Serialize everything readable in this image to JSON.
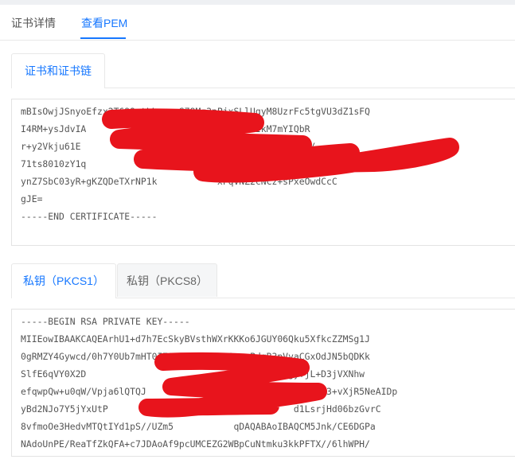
{
  "main_tabs": [
    {
      "label": "证书详情",
      "active": false
    },
    {
      "label": "查看PEM",
      "active": true
    }
  ],
  "cert_section": {
    "tab_label": "证书和证书链",
    "lines": [
      "mBIsOwjJSnyoEfzx2T699ctLLrvuzS79Mg3pPjxSLlUgyM8UzrFc5tgVU3dZ1sFQ",
      "I4RM+ysJdvIA               eqwM3fY3WfQkRTzhIkM7mYIQbR",
      "r+y2Vkju61E                                         6/",
      "71ts8010zY1q                  jdpn+bWUxTKWaMY0qedSCkWE",
      "ynZ7SbC03yR+gKZQDeTXrNP1k           xFqVNZ2cNCz+sPxeOwdCcC",
      "gJE=",
      "-----END CERTIFICATE-----"
    ]
  },
  "key_section": {
    "tabs": [
      {
        "label": "私钥（PKCS1）",
        "active": true
      },
      {
        "label": "私钥（PKCS8）",
        "active": false
      }
    ],
    "lines": [
      "-----BEGIN RSA PRIVATE KEY-----",
      "MIIEowIBAAKCAQEArhU1+d7h7EcSkyBVsthWXrKKKo6JGUY06Qku5XfkcZZMSg1J",
      "0gRMZY4Gywcd/0h7Y0Ub7mHT0I70KBDm1N0KyK0+v+PdqB3pVyaCGxOdJN5bQDKk",
      "SlfE6qVY0X2D                              y52WauigyfjL+D3jVXNhw",
      "efqwpQw+u0qW/Vpja6lQTQJ                 zR0S4NU5jhUVzVwT3+vXjR5NeAIDp",
      "yBd2NJo7Y5jYxUtP                                  d1LsrjHd06bzGvrC",
      "8vfmoOe3HedvMTQtIYd1pS//UZm5           qDAQABAoIBAQCM5Jnk/CE6DGPa",
      "NAdoUnPE/ReaTfZkQFA+c7JDAoAf9pcUMCEZG2WBpCuNtmku3kkPFTX//6lhWPH/"
    ]
  },
  "colors": {
    "accent": "#1677ff",
    "redaction": "#e8141c"
  }
}
